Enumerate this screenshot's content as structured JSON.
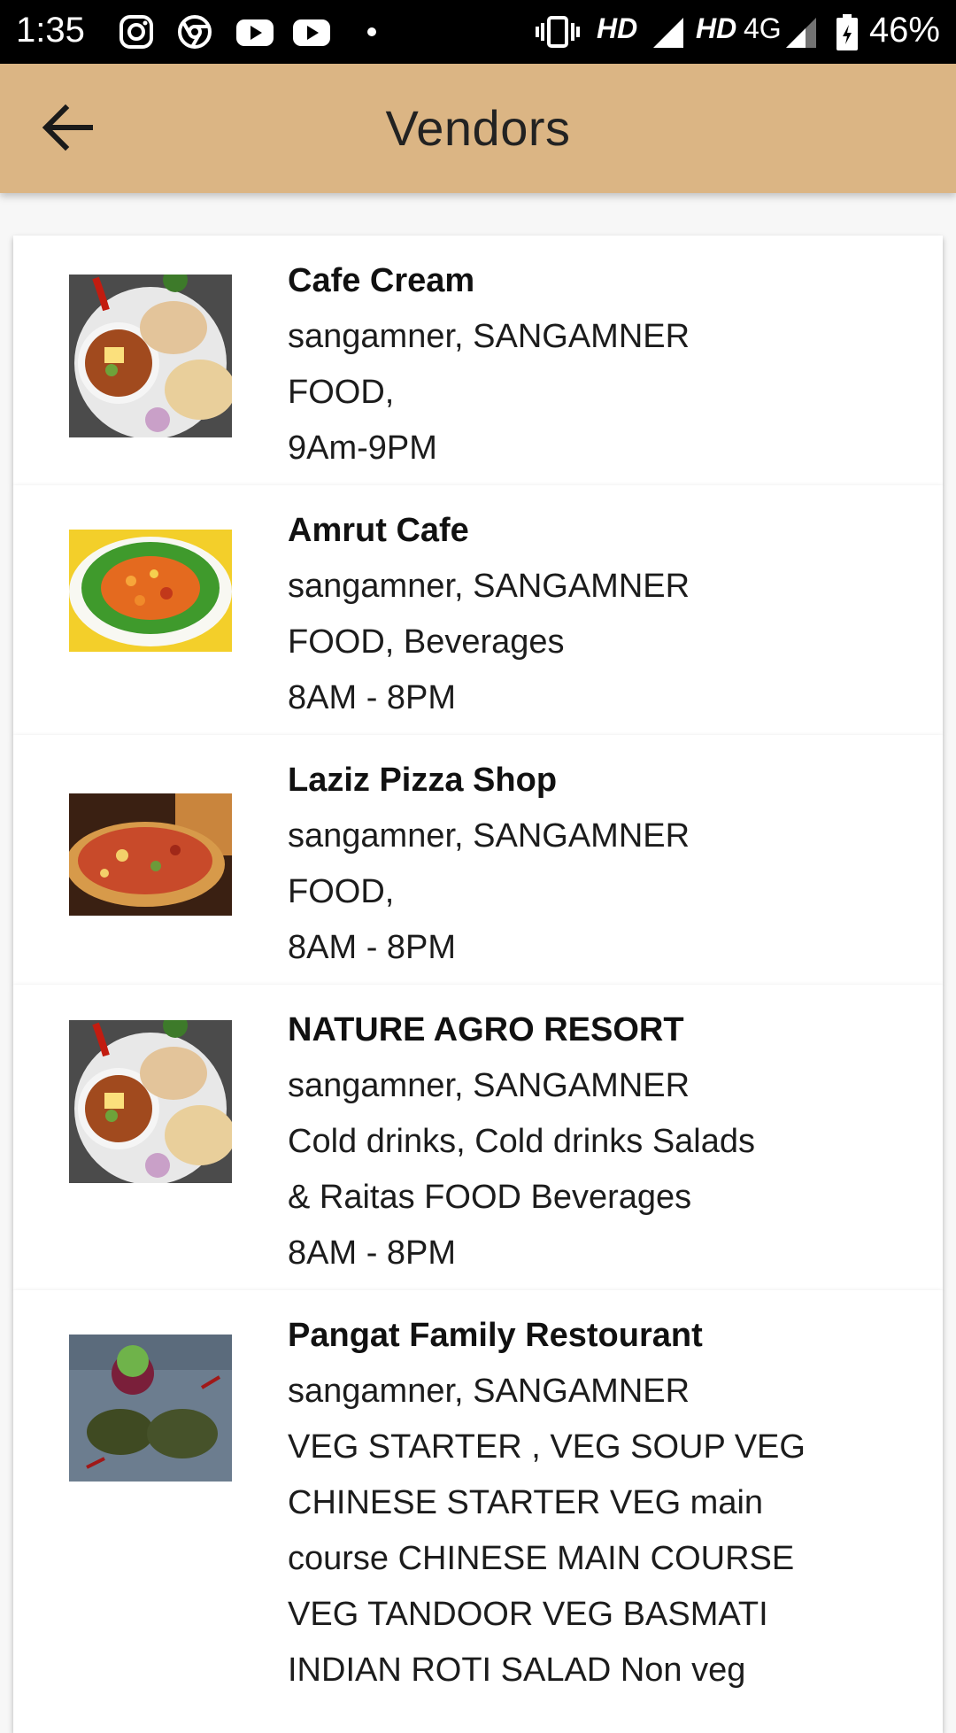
{
  "status_bar": {
    "time": "1:35",
    "hd1": "HD",
    "hd2": "HD",
    "network": "4G",
    "battery": "46%",
    "icons": [
      "instagram-icon",
      "chrome-icon",
      "youtube-icon",
      "youtube-icon",
      "dot-icon",
      "vibrate-icon",
      "signal-icon",
      "signal-icon",
      "battery-icon"
    ]
  },
  "app_bar": {
    "title": "Vendors",
    "back_icon": "arrow-back-icon"
  },
  "vendors": [
    {
      "name": "Cafe Cream",
      "location": "sangamner, SANGAMNER",
      "categories": [
        "FOOD,"
      ],
      "hours": "9Am-9PM",
      "image": "pav-bhaji-image"
    },
    {
      "name": "Amrut Cafe",
      "location": "sangamner, SANGAMNER",
      "categories": [
        "FOOD, Beverages"
      ],
      "hours": "8AM - 8PM",
      "image": "salad-plate-image"
    },
    {
      "name": "Laziz Pizza Shop",
      "location": "sangamner, SANGAMNER",
      "categories": [
        "FOOD,"
      ],
      "hours": "8AM - 8PM",
      "image": "pizza-image"
    },
    {
      "name": "NATURE AGRO RESORT",
      "location": "sangamner, SANGAMNER",
      "categories": [
        "Cold drinks, Cold drinks Salads",
        "& Raitas FOOD Beverages"
      ],
      "hours": "8AM - 8PM",
      "image": "pav-bhaji-image"
    },
    {
      "name": "Pangat Family Restourant",
      "location": "sangamner, SANGAMNER",
      "categories": [
        "VEG STARTER , VEG SOUP VEG",
        "CHINESE STARTER VEG main",
        "course CHINESE MAIN COURSE",
        "VEG TANDOOR VEG BASMATI",
        "INDIAN ROTI SALAD Non veg"
      ],
      "hours": "",
      "image": "kebab-plate-image"
    }
  ]
}
